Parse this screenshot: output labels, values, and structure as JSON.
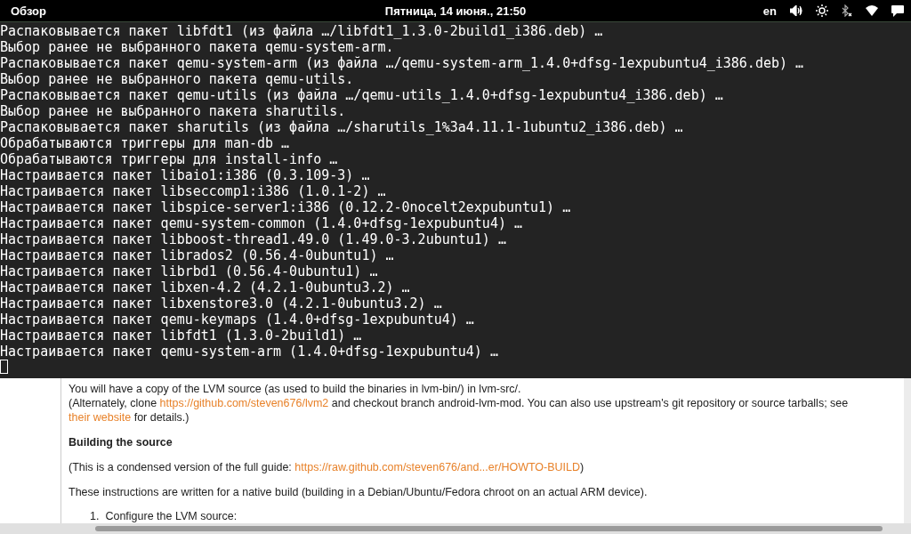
{
  "top_bar": {
    "activities": "Обзор",
    "clock": "Пятница, 14 июня., 21:50",
    "keyboard_layout": "en"
  },
  "terminal": {
    "lines": [
      "Распаковывается пакет libfdt1 (из файла …/libfdt1_1.3.0-2build1_i386.deb) …",
      "Выбор ранее не выбранного пакета qemu-system-arm.",
      "Распаковывается пакет qemu-system-arm (из файла …/qemu-system-arm_1.4.0+dfsg-1expubuntu4_i386.deb) …",
      "Выбор ранее не выбранного пакета qemu-utils.",
      "Распаковывается пакет qemu-utils (из файла …/qemu-utils_1.4.0+dfsg-1expubuntu4_i386.deb) …",
      "Выбор ранее не выбранного пакета sharutils.",
      "Распаковывается пакет sharutils (из файла …/sharutils_1%3a4.11.1-1ubuntu2_i386.deb) …",
      "Обрабатываются триггеры для man-db …",
      "Обрабатываются триггеры для install-info …",
      "Настраивается пакет libaio1:i386 (0.3.109-3) …",
      "Настраивается пакет libseccomp1:i386 (1.0.1-2) …",
      "Настраивается пакет libspice-server1:i386 (0.12.2-0nocelt2expubuntu1) …",
      "Настраивается пакет qemu-system-common (1.4.0+dfsg-1expubuntu4) …",
      "Настраивается пакет libboost-thread1.49.0 (1.49.0-3.2ubuntu1) …",
      "Настраивается пакет librados2 (0.56.4-0ubuntu1) …",
      "Настраивается пакет librbd1 (0.56.4-0ubuntu1) …",
      "Настраивается пакет libxen-4.2 (4.2.1-0ubuntu3.2) …",
      "Настраивается пакет libxenstore3.0 (4.2.1-0ubuntu3.2) …",
      "Настраивается пакет qemu-keymaps (1.4.0+dfsg-1expubuntu4) …",
      "Настраивается пакет libfdt1 (1.3.0-2build1) …",
      "Настраивается пакет qemu-system-arm (1.4.0+dfsg-1expubuntu4) …"
    ]
  },
  "page": {
    "blocks": [
      {
        "kind": "text",
        "parts": [
          {
            "kind": "text",
            "text": "You will have a copy of the LVM source (as used to build the binaries in lvm-bin/) in lvm-src/."
          }
        ]
      },
      {
        "kind": "text",
        "parts": [
          {
            "kind": "text",
            "text": "(Alternately, clone "
          },
          {
            "kind": "link",
            "text": "https://github.com/steven676/lvm2"
          },
          {
            "kind": "text",
            "text": " and checkout branch android-lvm-mod. You can also use upstream's git repository or source tarballs; see "
          },
          {
            "kind": "link",
            "text": "their website"
          },
          {
            "kind": "text",
            "text": " for details.)"
          }
        ]
      },
      {
        "kind": "heading",
        "parts": [
          {
            "kind": "text",
            "text": "Building the source"
          }
        ]
      },
      {
        "kind": "text",
        "parts": [
          {
            "kind": "text",
            "text": "(This is a condensed version of the full guide: "
          },
          {
            "kind": "link",
            "text": "https://raw.github.com/steven676/and...er/HOWTO-BUILD"
          },
          {
            "kind": "text",
            "text": ")"
          }
        ]
      },
      {
        "kind": "text",
        "parts": [
          {
            "kind": "text",
            "text": "These instructions are written for a native build (building in a Debian/Ubuntu/Fedora chroot on an actual ARM device)."
          }
        ]
      },
      {
        "kind": "list_item",
        "number": "1.",
        "text": "Configure the LVM source:"
      }
    ]
  }
}
